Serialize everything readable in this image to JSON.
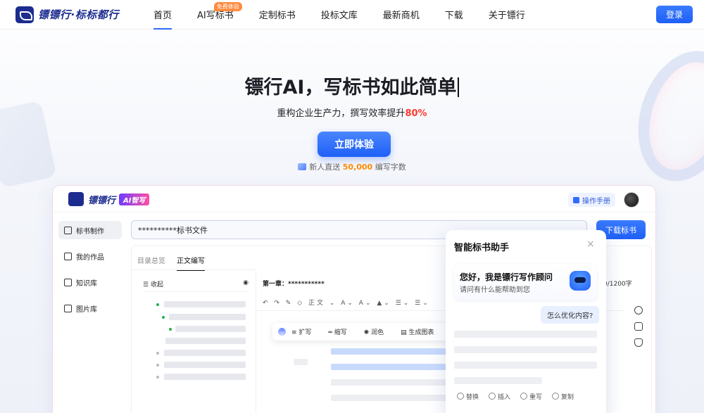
{
  "header": {
    "logo_text": "镖镖行·标标都行",
    "nav": [
      {
        "label": "首页",
        "active": true,
        "badge": ""
      },
      {
        "label": "AI写标书",
        "active": false,
        "badge": "免费体验"
      },
      {
        "label": "定制标书",
        "active": false,
        "badge": ""
      },
      {
        "label": "投标文库",
        "active": false,
        "badge": ""
      },
      {
        "label": "最新商机",
        "active": false,
        "badge": ""
      },
      {
        "label": "下载",
        "active": false,
        "badge": ""
      },
      {
        "label": "关于镖行",
        "active": false,
        "badge": ""
      }
    ],
    "login_label": "登录"
  },
  "hero": {
    "title": "镖行AI，写标书如此简单",
    "subtitle_prefix": "重构企业生产力，撰写效率提升",
    "subtitle_highlight": "80%",
    "cta_label": "立即体验",
    "promo_prefix": "新人直送 ",
    "promo_number": "50,000",
    "promo_suffix": " 编写字数"
  },
  "app": {
    "logo_text": "镖镖行",
    "logo_badge": "AI智写",
    "manual_label": "操作手册",
    "sidebar": [
      {
        "label": "标书制作",
        "active": true,
        "icon": "pen-icon"
      },
      {
        "label": "我的作品",
        "active": false,
        "icon": "book-icon"
      },
      {
        "label": "知识库",
        "active": false,
        "icon": "folder-icon"
      },
      {
        "label": "图片库",
        "active": false,
        "icon": "image-icon"
      }
    ],
    "doc_name": "**********标书文件",
    "download_label": "下载标书",
    "tabs": [
      "目录总览",
      "正文编写"
    ],
    "outline_label": "收起",
    "chapter_title": "第一章：***********",
    "word_count": "0/1200字",
    "toolbar_text": "↶ ↷ ✎ ◇   正文   ⌄ A⌄ A⌄ ▲⌄ ☰⌄ ☰⌄",
    "float_tools": [
      "扩写",
      "缩写",
      "润色",
      "生成图表"
    ]
  },
  "assistant": {
    "title": "智能标书助手",
    "close": "×",
    "greeting": "您好，我是镖行写作顾问",
    "greeting_sub": "请问有什么能帮助到您",
    "user_question": "怎么优化内容?",
    "actions": [
      "替换",
      "插入",
      "重写",
      "复制"
    ]
  }
}
